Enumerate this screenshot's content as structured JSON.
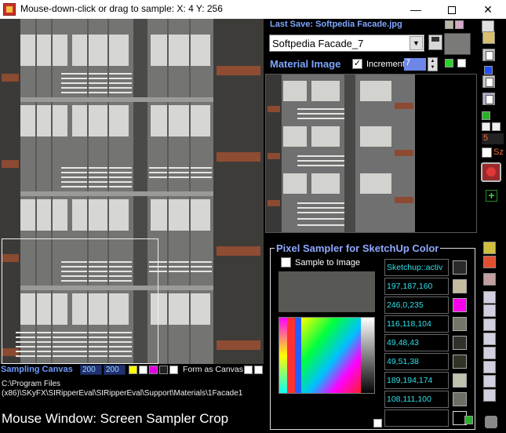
{
  "window": {
    "title": "Mouse-down-click or drag to sample: X: 4  Y: 256",
    "minimize": "—",
    "close": "✕"
  },
  "sampling": {
    "label": "Sampling Canvas",
    "width": "200",
    "height": "200",
    "form_as_canvas": "Form as Canvas",
    "swatch_colors": [
      "#ffff00",
      "#ffffff",
      "#e000e0",
      "#202020",
      "#ffffff"
    ]
  },
  "path": {
    "line1": "C:\\Program Files",
    "line2": "(x86)\\SKyFX\\SIRipperEval\\SIRipperEval\\Support\\Materials\\1Facade1"
  },
  "footer": {
    "caption": "Mouse Window: Screen Sampler Crop"
  },
  "material": {
    "last_save": "Last Save: Softpedia Facade.jpg",
    "name": "Softpedia Facade_7",
    "image_label": "Material Image",
    "increment_label": "Increment",
    "increment_value": "7"
  },
  "sampler": {
    "title": "Pixel Sampler for SketchUp Color",
    "sample_to_image": "Sample to Image",
    "preview_color": "#585855",
    "values": [
      {
        "text": "Sketchup::activ",
        "color": "#2a2a2a"
      },
      {
        "text": "197,187,160",
        "color": "#c5bba0"
      },
      {
        "text": "246,0,235",
        "color": "#f600eb"
      },
      {
        "text": "116,118,104",
        "color": "#747668"
      },
      {
        "text": "49,48,43",
        "color": "#31302b"
      },
      {
        "text": "49,51,38",
        "color": "#313326"
      },
      {
        "text": "189,194,174",
        "color": "#bdc2ae"
      },
      {
        "text": "108,111,100",
        "color": "#6c6f64"
      }
    ]
  },
  "toolbar": {
    "counter": "5",
    "size_label": "Sz"
  },
  "colors": {
    "accent_blue": "#7ea6ff",
    "value_cyan": "#2fe0ea",
    "increment_bg": "#6d86e8"
  },
  "icons": [
    "app-icon",
    "save-icon",
    "open-folder-icon",
    "paste-icon",
    "ruby-icon",
    "add-icon",
    "gradient-icon",
    "settings-icon"
  ]
}
